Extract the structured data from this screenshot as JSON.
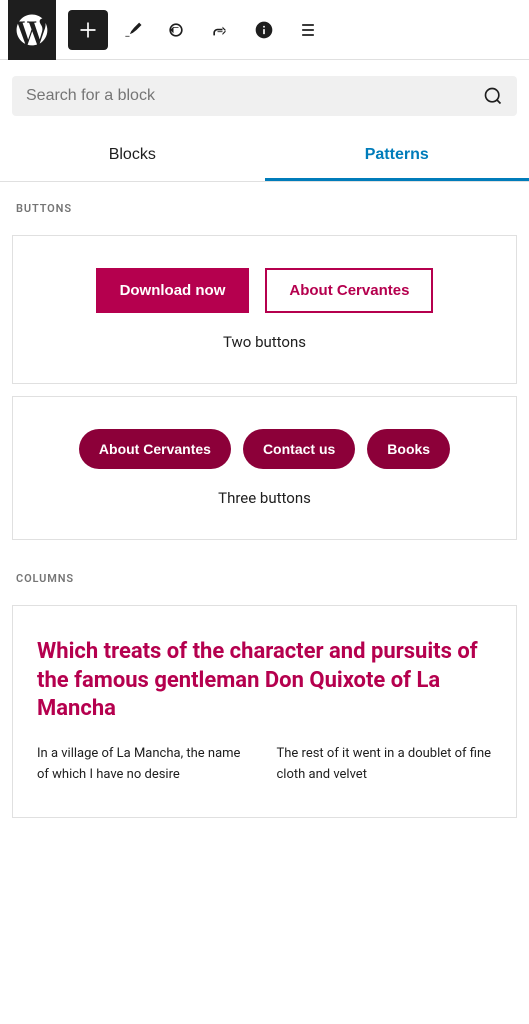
{
  "toolbar": {
    "wp_logo_label": "WordPress",
    "add_button_label": "+",
    "edit_icon": "pencil",
    "undo_icon": "undo",
    "redo_icon": "redo",
    "info_icon": "info",
    "menu_icon": "menu"
  },
  "search": {
    "placeholder": "Search for a block",
    "icon": "search-icon"
  },
  "tabs": [
    {
      "id": "blocks",
      "label": "Blocks",
      "active": false
    },
    {
      "id": "patterns",
      "label": "Patterns",
      "active": true
    }
  ],
  "sections": {
    "buttons": {
      "label": "BUTTONS",
      "patterns": [
        {
          "id": "two-buttons",
          "buttons": [
            {
              "label": "Download now",
              "style": "primary"
            },
            {
              "label": "About Cervantes",
              "style": "outline"
            }
          ],
          "caption": "Two buttons"
        },
        {
          "id": "three-buttons",
          "buttons": [
            {
              "label": "About Cervantes",
              "style": "pill"
            },
            {
              "label": "Contact us",
              "style": "pill"
            },
            {
              "label": "Books",
              "style": "pill"
            }
          ],
          "caption": "Three buttons"
        }
      ]
    },
    "columns": {
      "label": "COLUMNS",
      "patterns": [
        {
          "id": "column-text",
          "heading": "Which treats of the character and pursuits of the famous gentleman Don Quixote of La Mancha",
          "col1": "In a village of La Mancha, the name of which I have no desire",
          "col2": "The rest of it went in a doublet of fine cloth and velvet"
        }
      ]
    }
  }
}
